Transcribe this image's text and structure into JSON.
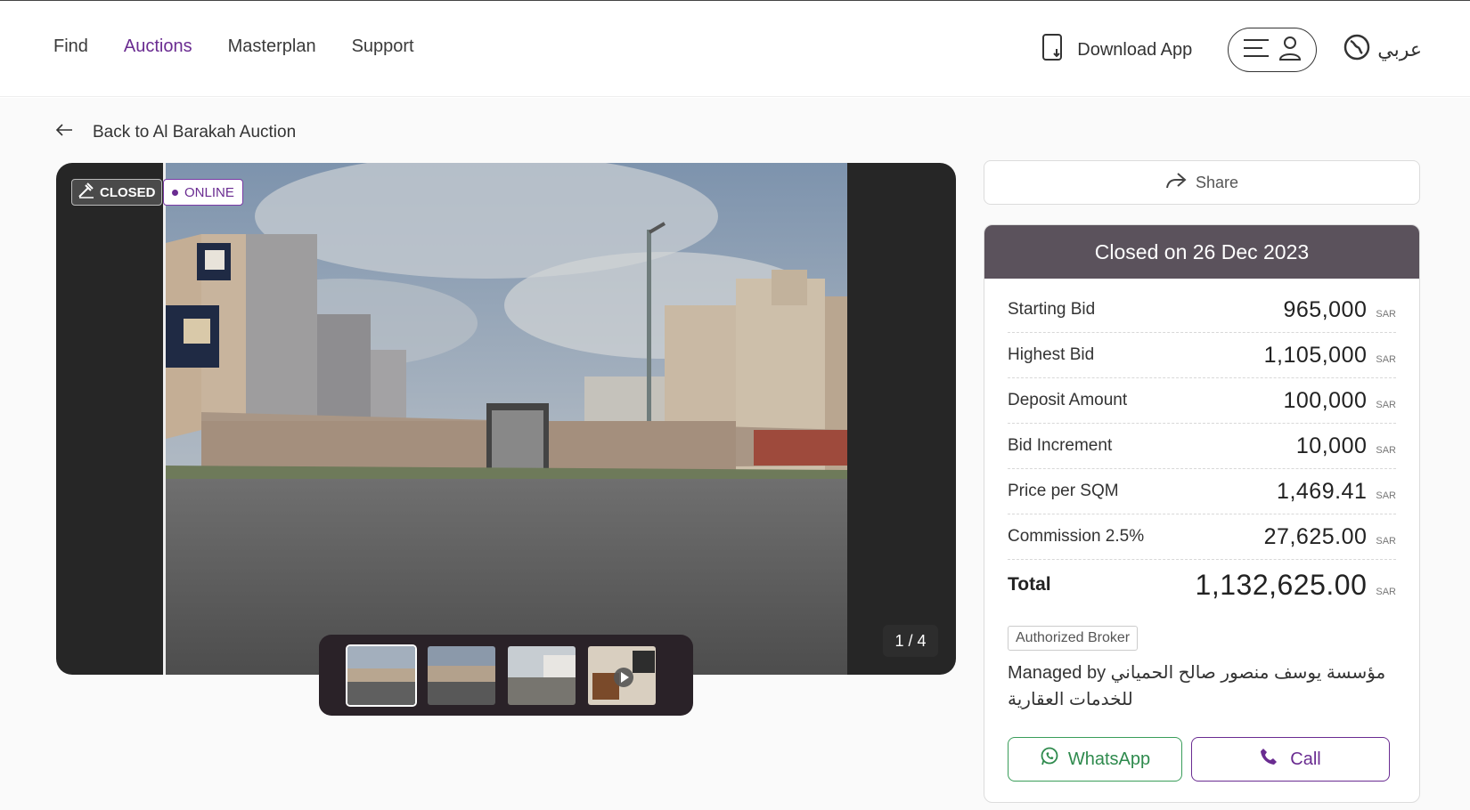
{
  "nav": {
    "items": [
      "Find",
      "Auctions",
      "Masterplan",
      "Support"
    ],
    "active": "Auctions",
    "download_label": "Download App",
    "language_label": "عربي"
  },
  "back_link": "Back to Al Barakah Auction",
  "gallery": {
    "closed_badge": "CLOSED",
    "online_badge": "ONLINE",
    "counter": "1 / 4",
    "thumb_count": 4
  },
  "share_label": "Share",
  "summary": {
    "header": "Closed on 26 Dec 2023",
    "currency": "SAR",
    "rows": [
      {
        "label": "Starting Bid",
        "value": "965,000"
      },
      {
        "label": "Highest Bid",
        "value": "1,105,000"
      },
      {
        "label": "Deposit Amount",
        "value": "100,000"
      },
      {
        "label": "Bid Increment",
        "value": "10,000"
      },
      {
        "label": "Price per SQM",
        "value": "1,469.41"
      },
      {
        "label": "Commission 2.5%",
        "value": "27,625.00"
      }
    ],
    "total": {
      "label": "Total",
      "value": "1,132,625.00"
    },
    "broker_tag": "Authorized Broker",
    "managed_by": "Managed by مؤسسة يوسف منصور صالح الحمياني للخدمات العقارية",
    "whatsapp_label": "WhatsApp",
    "call_label": "Call"
  },
  "colors": {
    "accent": "#6a2c91",
    "header_bar": "#5b525c",
    "whatsapp": "#2e8a4d"
  }
}
